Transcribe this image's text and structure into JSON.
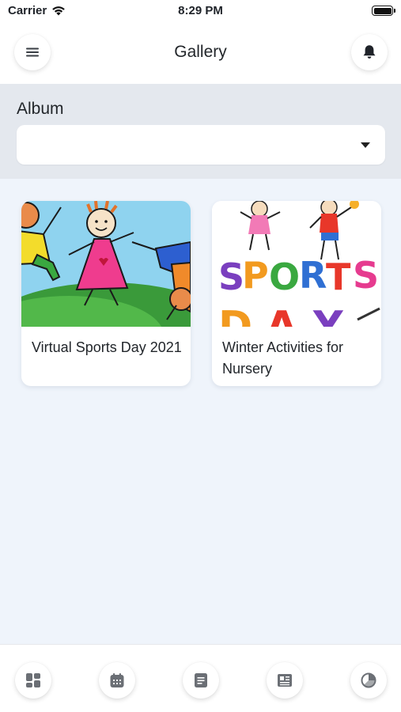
{
  "status_bar": {
    "carrier": "Carrier",
    "time": "8:29 PM",
    "wifi_icon": "wifi-icon",
    "battery_icon": "battery-icon"
  },
  "header": {
    "title": "Gallery",
    "menu_icon": "hamburger-menu-icon",
    "bell_icon": "bell-icon"
  },
  "album": {
    "label": "Album",
    "selected_value": "",
    "dropdown_icon": "caret-down-icon"
  },
  "gallery_items": [
    {
      "title": "Virtual Sports Day 2021",
      "thumbnail": "cartoon kids playing on grass"
    },
    {
      "title": "Winter Activities for Nursery",
      "thumbnail": "sports day colorful letters"
    }
  ],
  "bottom_nav": [
    {
      "icon": "dashboard-icon"
    },
    {
      "icon": "calendar-icon"
    },
    {
      "icon": "notes-icon"
    },
    {
      "icon": "news-icon"
    },
    {
      "icon": "pie-chart-icon"
    }
  ],
  "colors": {
    "accent_gray": "#e4e8ee",
    "content_bg": "#eff4fb",
    "icon_gray": "#6b6f75"
  }
}
